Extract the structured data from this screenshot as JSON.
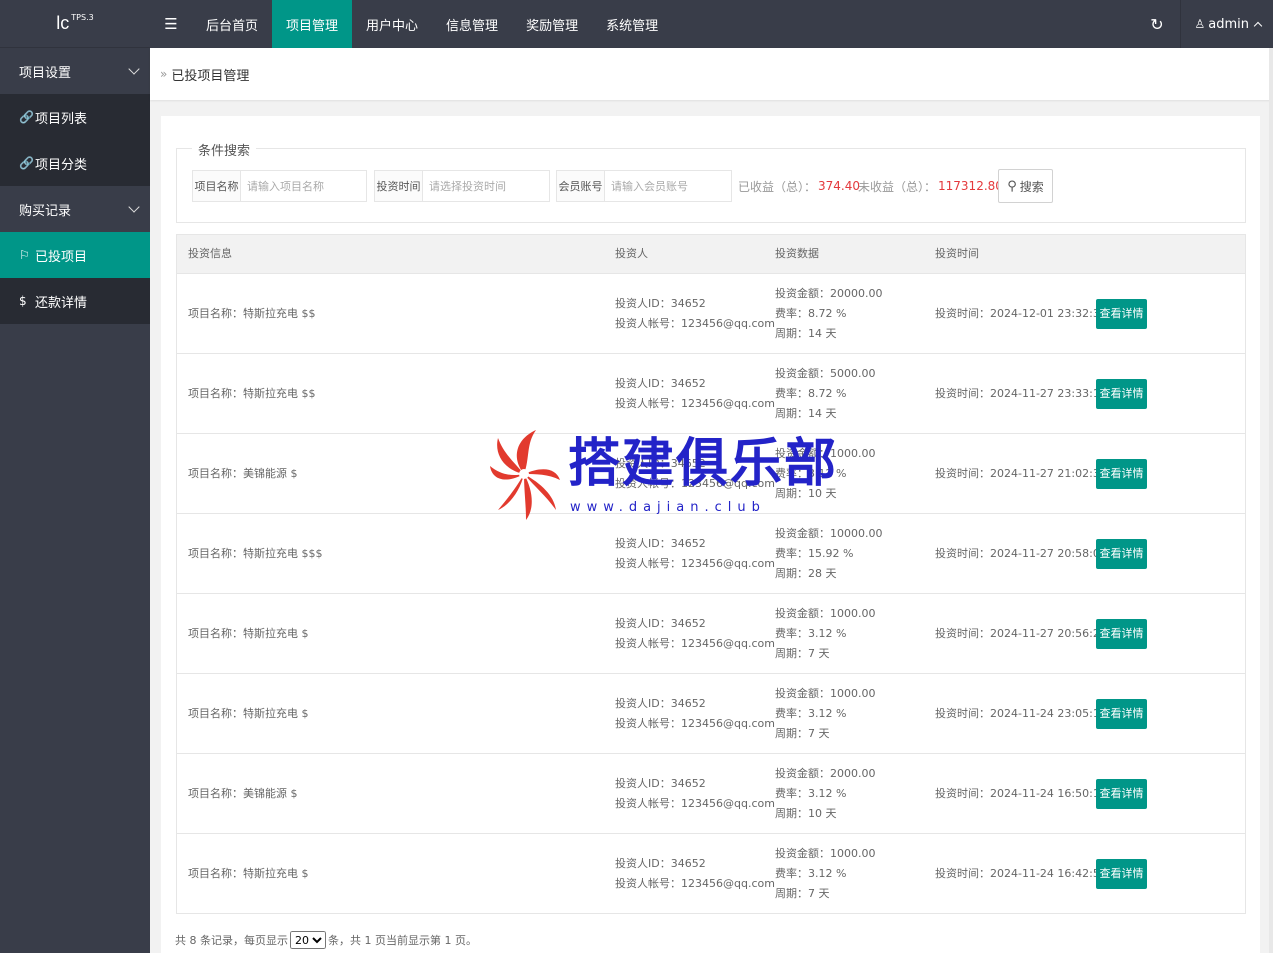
{
  "logo": {
    "text": "lc",
    "sup": "TPS.3"
  },
  "sidebar": {
    "groups": [
      {
        "label": "项目设置",
        "items": [
          {
            "icon": "🔗",
            "label": "项目列表"
          },
          {
            "icon": "🔗",
            "label": "项目分类"
          }
        ]
      },
      {
        "label": "购买记录",
        "items": [
          {
            "icon": "⚐",
            "label": "已投项目",
            "active": true
          },
          {
            "icon": "$",
            "label": "还款详情"
          }
        ]
      }
    ]
  },
  "topbar": {
    "toggle": "☰",
    "nav": [
      "后台首页",
      "项目管理",
      "用户中心",
      "信息管理",
      "奖励管理",
      "系统管理"
    ],
    "active_index": 1,
    "refresh": "↻",
    "user": "admin"
  },
  "breadcrumb": {
    "arrow": "»",
    "text": "已投项目管理"
  },
  "search": {
    "legend": "条件搜索",
    "fields": [
      {
        "label": "项目名称",
        "placeholder": "请输入项目名称"
      },
      {
        "label": "投资时间",
        "placeholder": "请选择投资时间"
      },
      {
        "label": "会员账号",
        "placeholder": "请输入会员账号"
      }
    ],
    "earned_label": "已收益（总）：",
    "earned_value": "374.40",
    "unearned_label": "未收益（总）：",
    "unearned_value": "117312.80",
    "button": "搜索"
  },
  "table": {
    "headers": [
      "投资信息",
      "投资人",
      "投资数据",
      "投资时间"
    ],
    "detail_label": "查看详情",
    "rows": [
      {
        "name": "项目名称：特斯拉充电 $$",
        "uid": "投资人ID：34652",
        "account": "投资人帐号：123456@qq.com",
        "amount": "投资金额：20000.00",
        "rate": "费率：8.72 %",
        "period": "周期：14 天",
        "time": "投资时间：2024-12-01 23:32:37"
      },
      {
        "name": "项目名称：特斯拉充电 $$",
        "uid": "投资人ID：34652",
        "account": "投资人帐号：123456@qq.com",
        "amount": "投资金额：5000.00",
        "rate": "费率：8.72 %",
        "period": "周期：14 天",
        "time": "投资时间：2024-11-27 23:33:16"
      },
      {
        "name": "项目名称：美锦能源 $",
        "uid": "投资人ID：34652",
        "account": "投资人帐号：123456@qq.com",
        "amount": "投资金额：1000.00",
        "rate": "费率：3.12 %",
        "period": "周期：10 天",
        "time": "投资时间：2024-11-27 21:02:32"
      },
      {
        "name": "项目名称：特斯拉充电 $$$",
        "uid": "投资人ID：34652",
        "account": "投资人帐号：123456@qq.com",
        "amount": "投资金额：10000.00",
        "rate": "费率：15.92 %",
        "period": "周期：28 天",
        "time": "投资时间：2024-11-27 20:58:01"
      },
      {
        "name": "项目名称：特斯拉充电 $",
        "uid": "投资人ID：34652",
        "account": "投资人帐号：123456@qq.com",
        "amount": "投资金额：1000.00",
        "rate": "费率：3.12 %",
        "period": "周期：7 天",
        "time": "投资时间：2024-11-27 20:56:29"
      },
      {
        "name": "项目名称：特斯拉充电 $",
        "uid": "投资人ID：34652",
        "account": "投资人帐号：123456@qq.com",
        "amount": "投资金额：1000.00",
        "rate": "费率：3.12 %",
        "period": "周期：7 天",
        "time": "投资时间：2024-11-24 23:05:19"
      },
      {
        "name": "项目名称：美锦能源 $",
        "uid": "投资人ID：34652",
        "account": "投资人帐号：123456@qq.com",
        "amount": "投资金额：2000.00",
        "rate": "费率：3.12 %",
        "period": "周期：10 天",
        "time": "投资时间：2024-11-24 16:50:14"
      },
      {
        "name": "项目名称：特斯拉充电 $",
        "uid": "投资人ID：34652",
        "account": "投资人帐号：123456@qq.com",
        "amount": "投资金额：1000.00",
        "rate": "费率：3.12 %",
        "period": "周期：7 天",
        "time": "投资时间：2024-11-24 16:42:50"
      }
    ]
  },
  "footer": {
    "pre": "共 8 条记录，每页显示",
    "page_size": "20",
    "post": "条，共 1 页当前显示第 1 页。"
  },
  "watermark": {
    "text": "搭建俱乐部",
    "url": "www.dajian.club"
  },
  "colors": {
    "sidebar": "#393d49",
    "accent": "#009688",
    "red": "#e4393c",
    "watermark": "#2323c8"
  }
}
